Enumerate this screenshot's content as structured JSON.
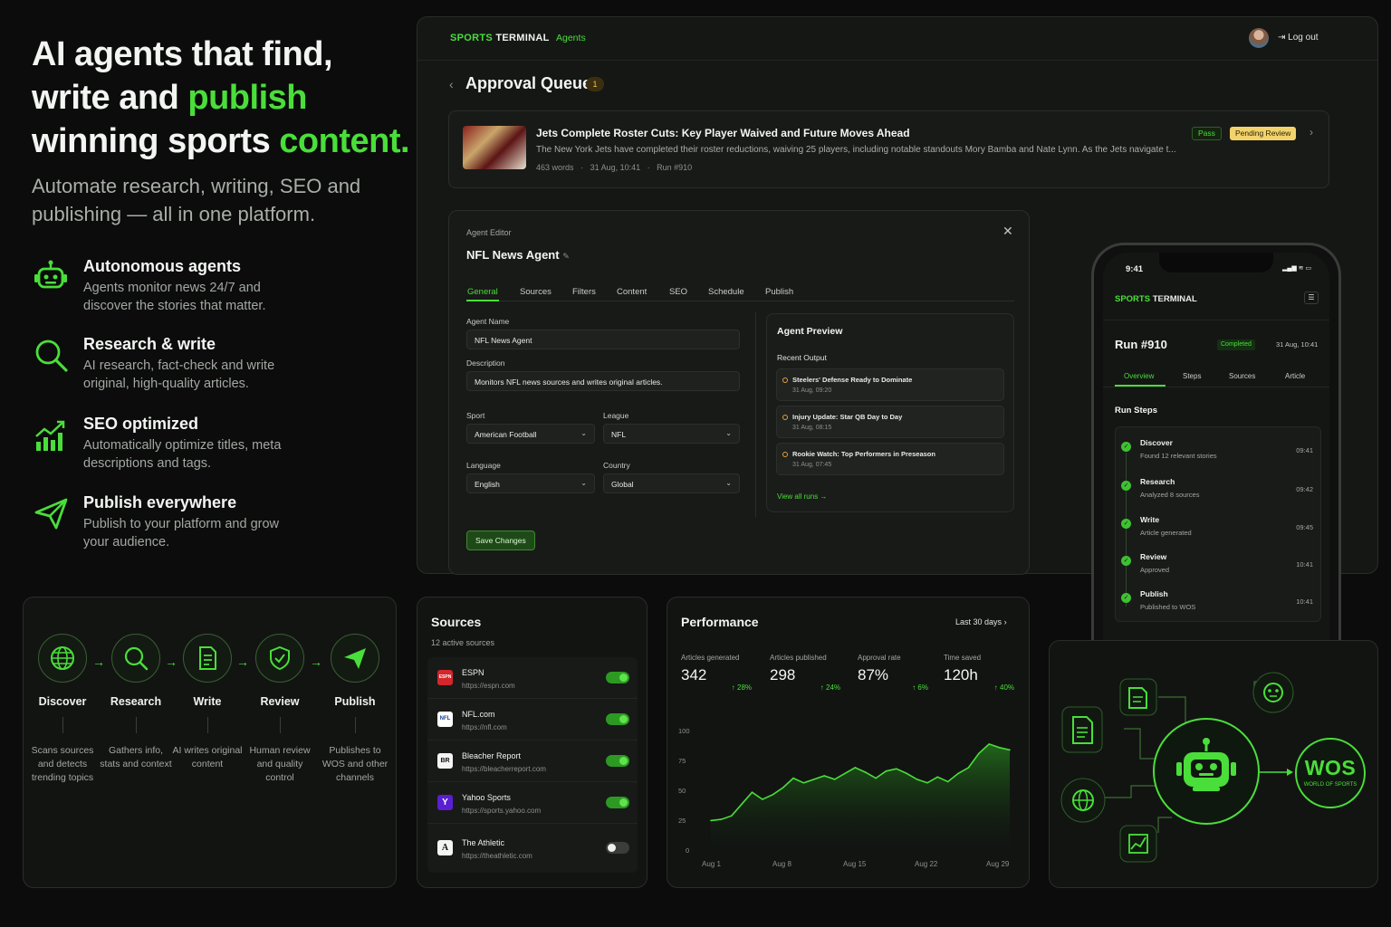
{
  "hero": {
    "line1": "AI agents that find,",
    "line2_a": "write and ",
    "line2_b": "publish",
    "line3_a": "winning sports ",
    "line3_b": "content.",
    "subtitle": "Automate research, writing, SEO and publishing — all in one platform."
  },
  "features": [
    {
      "icon": "robot-icon",
      "title": "Autonomous agents",
      "desc": "Agents monitor news 24/7 and discover the stories that matter."
    },
    {
      "icon": "search-icon",
      "title": "Research & write",
      "desc": "AI research, fact-check and write original, high-quality articles."
    },
    {
      "icon": "chart-up-icon",
      "title": "SEO optimized",
      "desc": "Automatically optimize titles, meta descriptions and tags."
    },
    {
      "icon": "send-icon",
      "title": "Publish everywhere",
      "desc": "Publish to your platform and grow your audience."
    }
  ],
  "pipeline": [
    {
      "icon": "globe-icon",
      "label": "Discover",
      "desc": "Scans sources and detects trending topics"
    },
    {
      "icon": "search-icon",
      "label": "Research",
      "desc": "Gathers info, stats and context"
    },
    {
      "icon": "document-icon",
      "label": "Write",
      "desc": "AI writes original content"
    },
    {
      "icon": "shield-check-icon",
      "label": "Review",
      "desc": "Human review and quality control"
    },
    {
      "icon": "send-icon",
      "label": "Publish",
      "desc": "Publishes to WOS and other channels"
    }
  ],
  "app": {
    "brand_a": "SPORTS",
    "brand_b": " TERMINAL",
    "nav": "Agents",
    "logout": "Log out",
    "queue_title": "Approval Queue",
    "queue_count": "1",
    "article": {
      "title": "Jets Complete Roster Cuts: Key Player Waived and Future Moves Ahead",
      "desc": "The New York Jets have completed their roster reductions, waiving 25 players, including notable standouts Mory Bamba and Nate Lynn. As the Jets navigate t...",
      "words": "463 words",
      "date": "31 Aug, 10:41",
      "run": "Run #910",
      "tag_pass": "Pass",
      "tag_pending": "Pending Review"
    },
    "editor": {
      "label": "Agent Editor",
      "title": "NFL News Agent",
      "tabs": [
        "General",
        "Sources",
        "Filters",
        "Content",
        "SEO",
        "Schedule",
        "Publish"
      ],
      "agent_name_label": "Agent Name",
      "agent_name": "NFL News Agent",
      "description_label": "Description",
      "description": "Monitors NFL news sources and writes original articles.",
      "sport_label": "Sport",
      "sport": "American Football",
      "league_label": "League",
      "league": "NFL",
      "language_label": "Language",
      "language": "English",
      "country_label": "Country",
      "country": "Global",
      "save": "Save Changes",
      "preview_title": "Agent Preview",
      "recent_label": "Recent Output",
      "recent": [
        {
          "title": "Steelers' Defense Ready to Dominate",
          "date": "31 Aug, 09:20"
        },
        {
          "title": "Injury Update: Star QB Day to Day",
          "date": "31 Aug, 08:15"
        },
        {
          "title": "Rookie Watch: Top Performers in Preseason",
          "date": "31 Aug, 07:45"
        }
      ],
      "view_all": "View all runs →"
    }
  },
  "phone": {
    "time": "9:41",
    "status": "▂▄▆ ≋ ▭",
    "brand_a": "SPORTS",
    "brand_b": " TERMINAL",
    "run": "Run #910",
    "status_badge": "Completed",
    "date": "31 Aug, 10:41",
    "tabs": [
      "Overview",
      "Steps",
      "Sources",
      "Article"
    ],
    "steps_title": "Run Steps",
    "steps": [
      {
        "name": "Discover",
        "desc": "Found 12 relevant stories",
        "time": "09:41"
      },
      {
        "name": "Research",
        "desc": "Analyzed 8 sources",
        "time": "09:42"
      },
      {
        "name": "Write",
        "desc": "Article generated",
        "time": "09:45"
      },
      {
        "name": "Review",
        "desc": "Approved",
        "time": "10:41"
      },
      {
        "name": "Publish",
        "desc": "Published to WOS",
        "time": "10:41"
      }
    ]
  },
  "sources": {
    "title": "Sources",
    "subtitle": "12 active sources",
    "items": [
      {
        "name": "ESPN",
        "url": "https://espn.com",
        "logo": "ESPN",
        "logo_bg": "#d4262b",
        "logo_fg": "#ffffff",
        "enabled": true
      },
      {
        "name": "NFL.com",
        "url": "https://nfl.com",
        "logo": "NFL",
        "logo_bg": "#ffffff",
        "logo_fg": "#1a3d8f",
        "enabled": true
      },
      {
        "name": "Bleacher Report",
        "url": "https://bleacherreport.com",
        "logo": "BR",
        "logo_bg": "#f4f4f4",
        "logo_fg": "#111111",
        "enabled": true
      },
      {
        "name": "Yahoo Sports",
        "url": "https://sports.yahoo.com",
        "logo": "Y",
        "logo_bg": "#5a1fd1",
        "logo_fg": "#ffffff",
        "enabled": true
      },
      {
        "name": "The Athletic",
        "url": "https://theathletic.com",
        "logo": "A",
        "logo_bg": "#f4f4f4",
        "logo_fg": "#111111",
        "enabled": false
      }
    ]
  },
  "performance": {
    "title": "Performance",
    "range": "Last 30 days",
    "stats": [
      {
        "label": "Articles generated",
        "value": "342",
        "change": "↑ 28%"
      },
      {
        "label": "Articles published",
        "value": "298",
        "change": "↑ 24%"
      },
      {
        "label": "Approval rate",
        "value": "87%",
        "change": "↑ 6%"
      },
      {
        "label": "Time saved",
        "value": "120h",
        "change": "↑ 40%"
      }
    ]
  },
  "chart_data": {
    "type": "area",
    "title": "",
    "xlabel": "",
    "ylabel": "",
    "ylim": [
      0,
      100
    ],
    "yticks": [
      "100",
      "75",
      "50",
      "25",
      "0"
    ],
    "xticks": [
      "Aug 1",
      "Aug 8",
      "Aug 15",
      "Aug 22",
      "Aug 29"
    ],
    "x": [
      1,
      2,
      3,
      4,
      5,
      6,
      7,
      8,
      9,
      10,
      11,
      12,
      13,
      14,
      15,
      16,
      17,
      18,
      19,
      20,
      21,
      22,
      23,
      24,
      25,
      26,
      27,
      28,
      29,
      30
    ],
    "values": [
      22,
      23,
      26,
      36,
      46,
      40,
      44,
      50,
      58,
      54,
      57,
      60,
      57,
      62,
      67,
      63,
      58,
      64,
      66,
      62,
      57,
      54,
      59,
      55,
      62,
      67,
      79,
      87,
      84,
      82
    ],
    "line_color": "#4ade3a"
  },
  "integration": {
    "wos_title": "WOS",
    "wos_sub": "WORLD OF SPORTS"
  },
  "colors": {
    "accent": "#4ade3a",
    "background": "#0b0c0b",
    "pending": "#f2d36b"
  }
}
